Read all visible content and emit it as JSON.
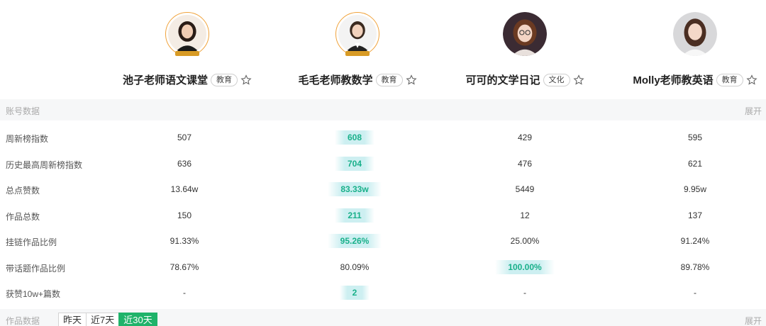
{
  "accounts": [
    {
      "name": "池子老师语文课堂",
      "tag": "教育",
      "avatar_icon": "avatar-icon"
    },
    {
      "name": "毛毛老师教数学",
      "tag": "教育",
      "avatar_icon": "avatar-icon"
    },
    {
      "name": "可可的文学日记",
      "tag": "文化",
      "avatar_icon": "avatar-icon"
    },
    {
      "name": "Molly老师教英语",
      "tag": "教育",
      "avatar_icon": "avatar-icon"
    }
  ],
  "account_section": {
    "title": "账号数据",
    "expand_label": "展开"
  },
  "metrics": [
    {
      "label": "周新榜指数",
      "values": [
        "507",
        "608",
        "429",
        "595"
      ],
      "highlight": 1
    },
    {
      "label": "历史最高周新榜指数",
      "values": [
        "636",
        "704",
        "476",
        "621"
      ],
      "highlight": 1
    },
    {
      "label": "总点赞数",
      "values": [
        "13.64w",
        "83.33w",
        "5449",
        "9.95w"
      ],
      "highlight": 1
    },
    {
      "label": "作品总数",
      "values": [
        "150",
        "211",
        "12",
        "137"
      ],
      "highlight": 1
    },
    {
      "label": "挂链作品比例",
      "values": [
        "91.33%",
        "95.26%",
        "25.00%",
        "91.24%"
      ],
      "highlight": 1
    },
    {
      "label": "带话题作品比例",
      "values": [
        "78.67%",
        "80.09%",
        "100.00%",
        "89.78%"
      ],
      "highlight": 2
    },
    {
      "label": "获赞10w+篇数",
      "values": [
        "-",
        "2",
        "-",
        "-"
      ],
      "highlight": 1
    }
  ],
  "works_section": {
    "title": "作品数据",
    "expand_label": "展开",
    "tabs": [
      "昨天",
      "近7天",
      "近30天"
    ],
    "active_tab": 2
  },
  "colors": {
    "highlight_text": "#19b08a",
    "highlight_bg": "#cdeff1",
    "active_tab": "#1fb36a",
    "avatar_ring": "#f0a23a"
  }
}
